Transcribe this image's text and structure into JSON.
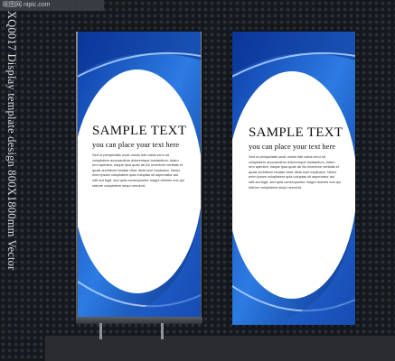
{
  "page_title": "XQ0017 Display template design 800X1800mm Vector",
  "watermark": "昵图网 nipic.com",
  "banners": [
    {
      "title": "SAMPLE TEXT",
      "subtitle": "you can place your text here",
      "body": "Sed ut perspiciatis unde omnis iste natus error sit voluptatem accusantium doloremque laudantium, totam rem aperiam, eaque ipsa quae ab illo inventore veritatis et quasi architecto beatae vitae dicta sunt explicabo. Nemo enim ipsam voluptatem quia voluptas sit aspernatur aut odit aut fugit, sed quia consequuntur magni dolores eos qui ratione voluptatem sequi nesciunt."
    },
    {
      "title": "SAMPLE TEXT",
      "subtitle": "you can place your text here",
      "body": "Sed ut perspiciatis unde omnis iste natus error sit voluptatem accusantium doloremque laudantium, totam rem aperiam, eaque ipsa quae ab illo inventore veritatis et quasi architecto beatae vitae dicta sunt explicabo. Nemo enim ipsam voluptatem quia voluptas sit aspernatur aut odit aut fugit, sed quia consequuntur magni dolores eos qui ratione voluptatem sequi nesciunt."
    }
  ],
  "colors": {
    "accent_blue": "#1f5fcf",
    "light_blue": "#7fb3f5",
    "background": "#15181c"
  }
}
